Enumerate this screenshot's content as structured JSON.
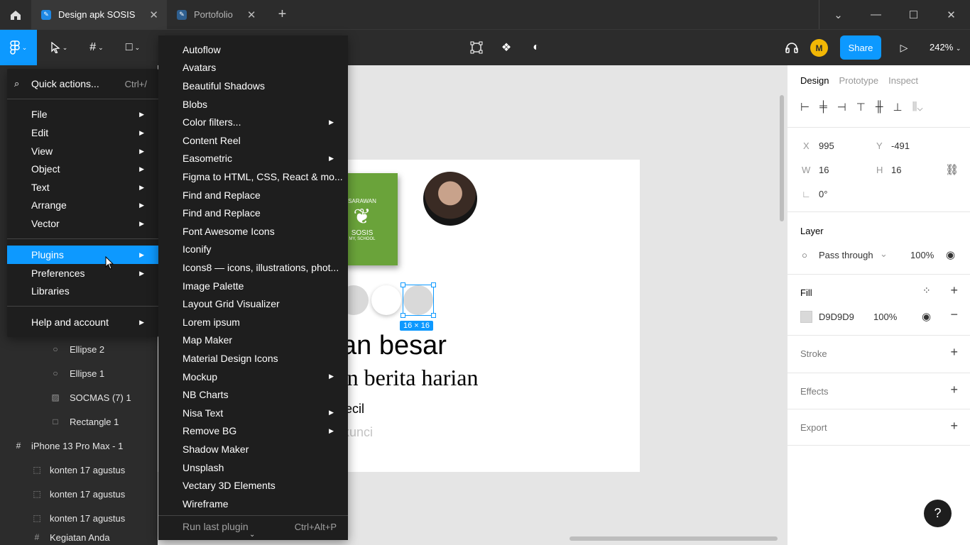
{
  "titlebar": {
    "tabs": [
      {
        "label": "Design apk SOSIS",
        "active": true
      },
      {
        "label": "Portofolio",
        "active": false
      }
    ]
  },
  "toolbar": {
    "share_label": "Share",
    "avatar_initial": "M",
    "zoom": "242%"
  },
  "canvas": {
    "selection_size": "16 × 16",
    "logo_text_top": "SARAWAN",
    "logo_text_mid": "SOSIS",
    "logo_text_bottom": "MY, SCHOOL",
    "heading_big": "san besar",
    "heading_serif": "san berita harian",
    "text_small": "n kecil",
    "text_grey": "terkunci"
  },
  "layers": {
    "rows": [
      {
        "icon": "ellipse",
        "label": "Ellipse 2"
      },
      {
        "icon": "ellipse",
        "label": "Ellipse 1"
      },
      {
        "icon": "image",
        "label": "SOCMAS (7) 1"
      },
      {
        "icon": "rect",
        "label": "Rectangle 1"
      },
      {
        "icon": "frame",
        "label": "iPhone 13 Pro Max - 1"
      },
      {
        "icon": "component",
        "label": "konten 17 agustus"
      },
      {
        "icon": "component",
        "label": "konten 17 agustus"
      },
      {
        "icon": "component",
        "label": "konten 17 agustus"
      },
      {
        "icon": "frame",
        "label": "Kegiatan Anda"
      }
    ]
  },
  "main_menu": {
    "quick_actions": "Quick actions...",
    "quick_shortcut": "Ctrl+/",
    "items": [
      "File",
      "Edit",
      "View",
      "Object",
      "Text",
      "Arrange",
      "Vector"
    ],
    "plugins": "Plugins",
    "preferences": "Preferences",
    "libraries": "Libraries",
    "help": "Help and account"
  },
  "plugins_menu": {
    "items": [
      "Autoflow",
      "Avatars",
      "Beautiful Shadows",
      "Blobs",
      "Color filters...",
      "Content Reel",
      "Easometric",
      "Figma to HTML, CSS, React & mo...",
      "Find and Replace",
      "Find and Replace",
      "Font Awesome Icons",
      "Iconify",
      "Icons8 — icons, illustrations, phot...",
      "Image Palette",
      "Layout Grid Visualizer",
      "Lorem ipsum",
      "Map Maker",
      "Material Design Icons",
      "Mockup",
      "NB Charts",
      "Nisa Text",
      "Remove BG",
      "Shadow Maker",
      "Unsplash",
      "Vectary 3D Elements",
      "Wireframe"
    ],
    "submenu_flags": [
      false,
      false,
      false,
      false,
      true,
      false,
      true,
      false,
      false,
      false,
      false,
      false,
      false,
      false,
      false,
      false,
      false,
      false,
      true,
      false,
      true,
      true,
      false,
      false,
      false,
      false
    ],
    "run_last": "Run last plugin",
    "run_last_shortcut": "Ctrl+Alt+P"
  },
  "right_panel": {
    "tabs": [
      "Design",
      "Prototype",
      "Inspect"
    ],
    "x_label": "X",
    "x": "995",
    "y_label": "Y",
    "y": "-491",
    "w_label": "W",
    "w": "16",
    "h_label": "H",
    "h": "16",
    "rotation": "0°",
    "layer_title": "Layer",
    "blend": "Pass through",
    "layer_opacity": "100%",
    "fill_title": "Fill",
    "fill_hex": "D9D9D9",
    "fill_opacity": "100%",
    "stroke_title": "Stroke",
    "effects_title": "Effects",
    "export_title": "Export",
    "help": "?"
  },
  "colors": {
    "accent": "#0d99ff",
    "fill": "#D9D9D9",
    "logo_green": "#6aa33a"
  }
}
